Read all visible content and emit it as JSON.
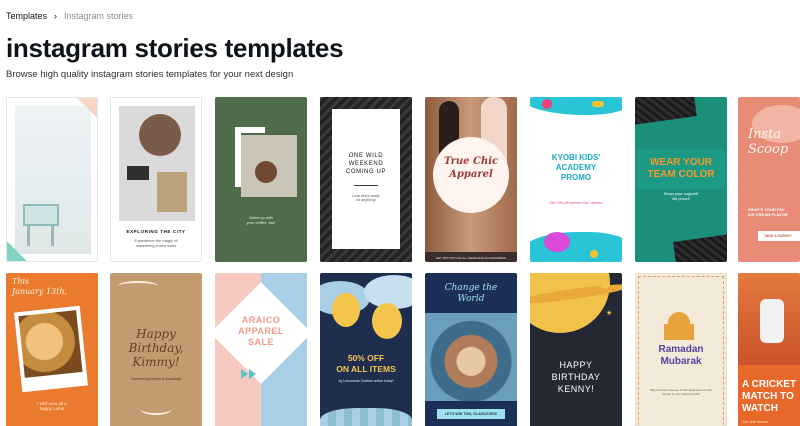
{
  "breadcrumb": {
    "items": [
      "Templates",
      "Instagram stories"
    ]
  },
  "page": {
    "title": "instagram stories templates",
    "subtitle": "Browse high quality instagram stories templates for your next design"
  },
  "cards": {
    "r1c2": {
      "heading": "EXPLORING THE CITY",
      "body": "Experience the magic of\nwandering a new town"
    },
    "r1c3": {
      "body": "Wake up with\nyour coffee, too!"
    },
    "r1c4": {
      "heading": "ONE WILD\nWEEKEND\nCOMING UP",
      "body": "Look who's ready\nfor anything!"
    },
    "r1c5": {
      "heading": "True Chic\nApparel",
      "footer": "GET 30% OFF ON ALL ITEMS AND ACCESSORIES"
    },
    "r1c6": {
      "heading": "KYOBI KIDS'\nACADEMY\nPROMO",
      "body": "Get 15% off summer kids' classes!"
    },
    "r1c7": {
      "heading": "WEAR YOUR\nTEAM COLOR",
      "body": "Show your support!\nBe proud!"
    },
    "r1c8": {
      "heading": "Insta\nScoop",
      "body": "WHAT'S YOUR FAV\nICE CREAM FLAVOR",
      "button": "TAKE A SURVEY"
    },
    "r2c1": {
      "heading": "This\nJanuary 13th,",
      "body": "I wish you all a\nhappy Lohri!"
    },
    "r2c2": {
      "heading": "Happy\nBirthday,\nKimmy!",
      "body": "Sincerest greetings & beautifully"
    },
    "r2c3": {
      "heading": "ARAICO\nAPPAREL\nSALE"
    },
    "r2c4": {
      "heading": "50% OFF\nON ALL ITEMS",
      "body": "by Lemonade Clothes online today!"
    },
    "r2c5": {
      "heading": "Change the\nWorld",
      "button": "LET'S WIN THIS, GLADIATORS!"
    },
    "r2c6": {
      "heading": "HAPPY\nBIRTHDAY\nKENNY!"
    },
    "r2c7": {
      "heading": "Ramadan\nMubarak",
      "body": "May the holy essence of this auspicious month\nremain in your heart and life!"
    },
    "r2c8": {
      "heading": "A CRICKET\nMATCH TO\nWATCH",
      "body": "Join the teams"
    }
  },
  "colors": {
    "green_dark": "#4f6b4c",
    "orange": "#e8702a",
    "teal": "#1f8a70",
    "navy": "#1f2e4f",
    "pink": "#f5b7b1",
    "blue_light": "#a9cfe6",
    "purple": "#6a3fa0"
  }
}
